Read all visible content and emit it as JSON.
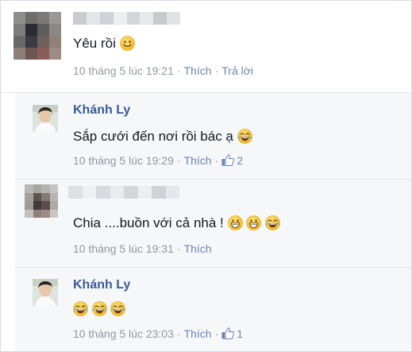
{
  "comments": [
    {
      "text": "Yêu rồi",
      "emojis": [
        "smile-emoji"
      ],
      "time": "10 tháng 5 lúc 19:21",
      "like_label": "Thích",
      "reply_label": "Trả lời",
      "name_obscured": true
    },
    {
      "author": "Khánh Ly",
      "text": "Sắp cưới đến nơi rồi bác ạ",
      "emojis": [
        "tears-of-joy-emoji"
      ],
      "time": "10 tháng 5 lúc 19:29",
      "like_label": "Thích",
      "like_count": "2"
    },
    {
      "text": "Chia ....buồn với cả nhà !",
      "emojis": [
        "grin-emoji",
        "grin-emoji",
        "tears-of-joy-emoji"
      ],
      "time": "10 tháng 5 lúc 19:31",
      "like_label": "Thích",
      "name_obscured": true
    },
    {
      "author": "Khánh Ly",
      "text": "",
      "emojis": [
        "tears-of-joy-emoji",
        "tears-of-joy-emoji",
        "tears-of-joy-emoji"
      ],
      "time": "10 tháng 5 lúc 23:03",
      "like_label": "Thích",
      "like_count": "1"
    }
  ],
  "colors": {
    "name_link": "#3b5998",
    "action_link": "#6d84b4",
    "meta_text": "#9197a3",
    "reply_background": "#f6f7f9",
    "emoji_yellow": "#f7c531"
  }
}
